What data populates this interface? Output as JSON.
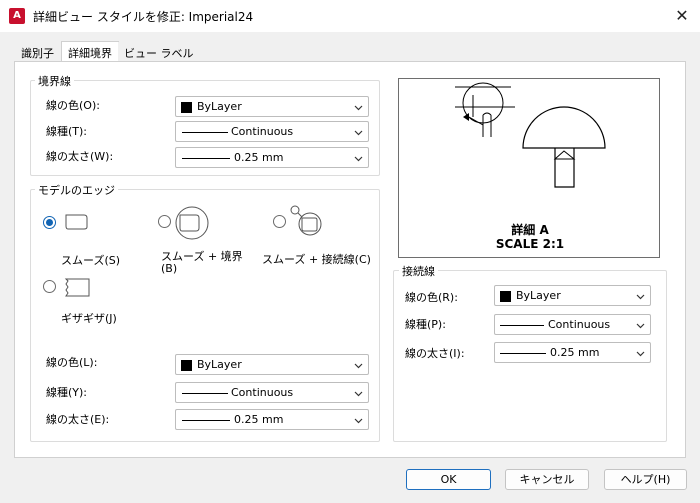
{
  "window": {
    "app_icon_letter": "A",
    "title": "詳細ビュー スタイルを修正: Imperial24",
    "close_glyph": "✕"
  },
  "tabs": [
    {
      "label": "識別子",
      "active": false
    },
    {
      "label": "詳細境界",
      "active": true
    },
    {
      "label": "ビュー ラベル",
      "active": false
    }
  ],
  "boundary": {
    "legend": "境界線",
    "color_label": "線の色(O):",
    "color_value": "ByLayer",
    "linetype_label": "線種(T):",
    "linetype_value": "Continuous",
    "lineweight_label": "線の太さ(W):",
    "lineweight_value": "0.25 mm"
  },
  "model_edge": {
    "legend": "モデルのエッジ",
    "options": [
      {
        "label": "スムーズ(S)",
        "checked": true
      },
      {
        "label": "スムーズ + 境界(B)",
        "checked": false
      },
      {
        "label": "スムーズ + 接続線(C)",
        "checked": false
      },
      {
        "label": "ギザギザ(J)",
        "checked": false
      }
    ],
    "color_label": "線の色(L):",
    "color_value": "ByLayer",
    "linetype_label": "線種(Y):",
    "linetype_value": "Continuous",
    "lineweight_label": "線の太さ(E):",
    "lineweight_value": "0.25 mm"
  },
  "preview": {
    "detail_title": "詳細 A",
    "scale_text": "SCALE 2:1"
  },
  "connection": {
    "legend": "接続線",
    "color_label": "線の色(R):",
    "color_value": "ByLayer",
    "linetype_label": "線種(P):",
    "linetype_value": "Continuous",
    "lineweight_label": "線の太さ(I):",
    "lineweight_value": "0.25 mm"
  },
  "buttons": {
    "ok": "OK",
    "cancel": "キャンセル",
    "help": "ヘルプ(H)"
  },
  "colors": {
    "radio_selected": "#1164b4",
    "default_button_border": "#1e6fbf",
    "app_icon": "#c8102e"
  }
}
